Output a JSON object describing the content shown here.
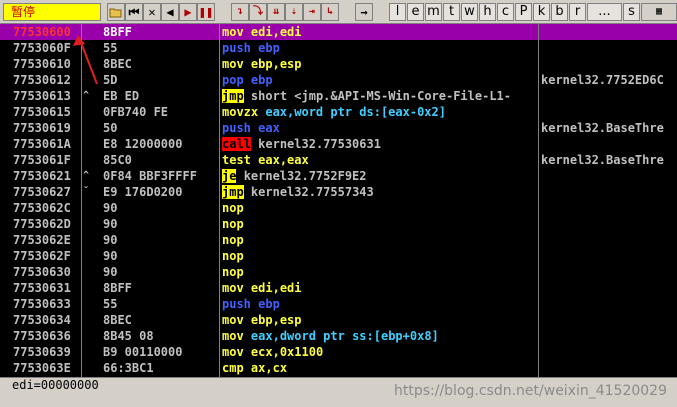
{
  "toolbar": {
    "status": "暂停",
    "letters": [
      "l",
      "e",
      "m",
      "t",
      "w",
      "h",
      "c",
      "P",
      "k",
      "b",
      "r",
      "...",
      "s"
    ]
  },
  "rows": [
    {
      "addr": "77530600",
      "mark": "",
      "hex": "8BFF",
      "mn": "mov",
      "ops": "edi,edi",
      "com": "",
      "selected": true
    },
    {
      "addr": "7753060F",
      "mark": "",
      "hex": "55",
      "mn": "push",
      "ops": "ebp",
      "com": ""
    },
    {
      "addr": "77530610",
      "mark": "",
      "hex": "8BEC",
      "mn": "mov",
      "ops": "ebp,esp",
      "com": ""
    },
    {
      "addr": "77530612",
      "mark": "",
      "hex": "5D",
      "mn": "pop",
      "ops": "ebp",
      "com": "kernel32.7752ED6C"
    },
    {
      "addr": "77530613",
      "mark": "^",
      "hex": "EB ED",
      "mn": "jmp",
      "ops": "short <jmp.&API-MS-Win-Core-File-L1-",
      "com": ""
    },
    {
      "addr": "77530615",
      "mark": "",
      "hex": "0FB740 FE",
      "mn": "movzx",
      "ops": "eax,word ptr ds:[eax-0x2]",
      "com": ""
    },
    {
      "addr": "77530619",
      "mark": "",
      "hex": "50",
      "mn": "push",
      "ops": "eax",
      "com": "kernel32.BaseThre"
    },
    {
      "addr": "7753061A",
      "mark": "",
      "hex": "E8 12000000",
      "mn": "call",
      "ops": "kernel32.77530631",
      "com": ""
    },
    {
      "addr": "7753061F",
      "mark": "",
      "hex": "85C0",
      "mn": "test",
      "ops": "eax,eax",
      "com": "kernel32.BaseThre"
    },
    {
      "addr": "77530621",
      "mark": "^",
      "hex": "0F84 BBF3FFFF",
      "mn": "je",
      "ops": "kernel32.7752F9E2",
      "com": ""
    },
    {
      "addr": "77530627",
      "mark": "ˇ",
      "hex": "E9 176D0200",
      "mn": "jmp",
      "ops": "kernel32.77557343",
      "com": ""
    },
    {
      "addr": "7753062C",
      "mark": "",
      "hex": "90",
      "mn": "nop",
      "ops": "",
      "com": ""
    },
    {
      "addr": "7753062D",
      "mark": "",
      "hex": "90",
      "mn": "nop",
      "ops": "",
      "com": ""
    },
    {
      "addr": "7753062E",
      "mark": "",
      "hex": "90",
      "mn": "nop",
      "ops": "",
      "com": ""
    },
    {
      "addr": "7753062F",
      "mark": "",
      "hex": "90",
      "mn": "nop",
      "ops": "",
      "com": ""
    },
    {
      "addr": "77530630",
      "mark": "",
      "hex": "90",
      "mn": "nop",
      "ops": "",
      "com": ""
    },
    {
      "addr": "77530631",
      "mark": "",
      "hex": "8BFF",
      "mn": "mov",
      "ops": "edi,edi",
      "com": ""
    },
    {
      "addr": "77530633",
      "mark": "",
      "hex": "55",
      "mn": "push",
      "ops": "ebp",
      "com": ""
    },
    {
      "addr": "77530634",
      "mark": "",
      "hex": "8BEC",
      "mn": "mov",
      "ops": "ebp,esp",
      "com": ""
    },
    {
      "addr": "77530636",
      "mark": "",
      "hex": "8B45 08",
      "mn": "mov",
      "ops": "eax,dword ptr ss:[ebp+0x8]",
      "com": ""
    },
    {
      "addr": "77530639",
      "mark": "",
      "hex": "B9 00110000",
      "mn": "mov",
      "ops": "ecx,0x1100",
      "com": ""
    },
    {
      "addr": "7753063E",
      "mark": "",
      "hex": "66:3BC1",
      "mn": "cmp",
      "ops": "ax,cx",
      "com": ""
    }
  ],
  "info": {
    "text": "edi=00000000"
  },
  "watermark": "https://blog.csdn.net/weixin_41520029",
  "colors": {
    "selected_row": "#9900aa",
    "push_pop": "#4060ff",
    "mov": "#ffff40",
    "jump_bg": "#ffff00",
    "call_bg": "#ff0000"
  }
}
